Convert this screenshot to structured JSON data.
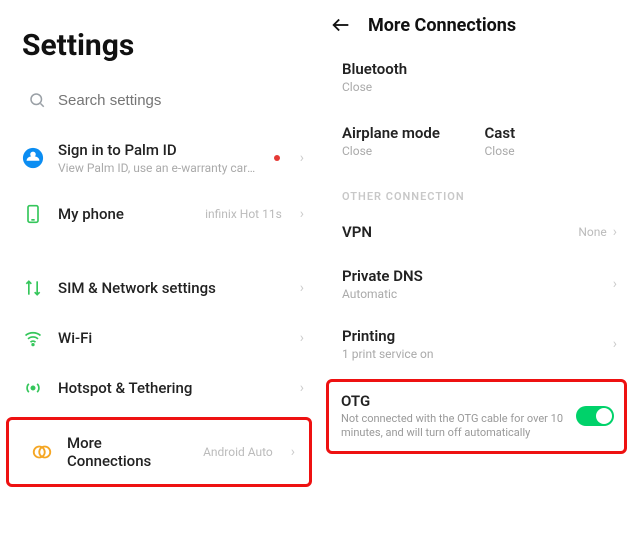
{
  "left": {
    "title": "Settings",
    "search_placeholder": "Search settings",
    "palm_id": {
      "title": "Sign in to Palm ID",
      "sub": "View Palm ID, use an e-warranty card, and ..."
    },
    "my_phone": {
      "title": "My phone",
      "right": "infinix Hot 11s"
    },
    "sim": {
      "title": "SIM & Network settings"
    },
    "wifi": {
      "title": "Wi-Fi"
    },
    "hotspot": {
      "title": "Hotspot & Tethering"
    },
    "more": {
      "title": "More Connections",
      "right": "Android Auto"
    }
  },
  "right": {
    "header": "More Connections",
    "bluetooth": {
      "title": "Bluetooth",
      "sub": "Close"
    },
    "airplane": {
      "title": "Airplane mode",
      "sub": "Close"
    },
    "cast": {
      "title": "Cast",
      "sub": "Close"
    },
    "section_other": "OTHER CONNECTION",
    "vpn": {
      "title": "VPN",
      "right": "None"
    },
    "pdns": {
      "title": "Private DNS",
      "sub": "Automatic"
    },
    "printing": {
      "title": "Printing",
      "sub": "1 print service on"
    },
    "otg": {
      "title": "OTG",
      "sub": "Not connected with the OTG cable for over 10 minutes, and will turn off automatically",
      "toggle": true
    }
  }
}
